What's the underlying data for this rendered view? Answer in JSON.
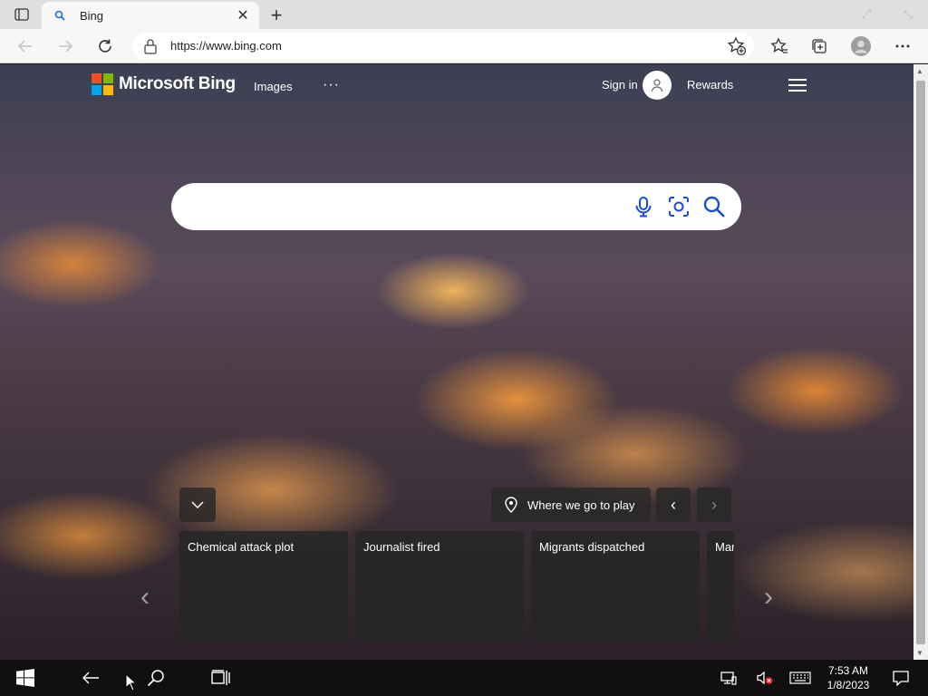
{
  "browser": {
    "tab": {
      "title": "Bing"
    },
    "address": {
      "url": "https://www.bing.com"
    }
  },
  "bing": {
    "brand": "Microsoft Bing",
    "nav": {
      "images": "Images",
      "more": "···"
    },
    "sign_in": "Sign in",
    "rewards": "Rewards",
    "search": {
      "value": "",
      "placeholder": ""
    },
    "location": "Where we go to play",
    "news_cards": [
      {
        "title": "Chemical attack plot"
      },
      {
        "title": "Journalist fired"
      },
      {
        "title": "Migrants dispatched"
      },
      {
        "title": "Mar"
      }
    ]
  },
  "taskbar": {
    "time": "7:53 AM",
    "date": "1/8/2023"
  },
  "colors": {
    "ms_red": "#f25022",
    "ms_green": "#7fba00",
    "ms_blue": "#00a4ef",
    "ms_yellow": "#ffb900",
    "bing_blue": "#174ae4"
  }
}
